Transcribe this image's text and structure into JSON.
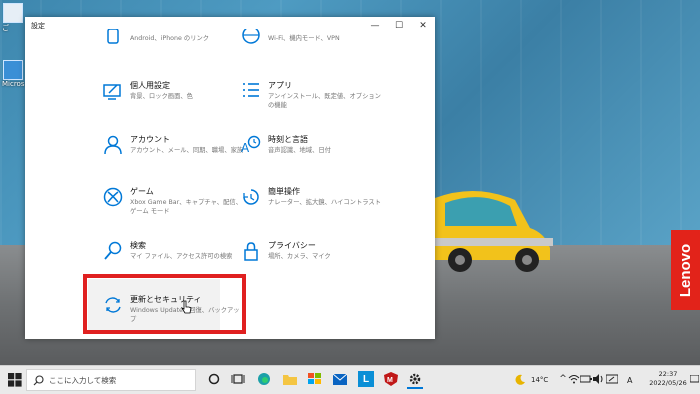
{
  "window": {
    "title": "設定",
    "controls": {
      "minimize": "—",
      "maximize": "☐",
      "close": "✕"
    }
  },
  "settings": {
    "partial_left": {
      "name": "",
      "desc": "Android、iPhone のリンク"
    },
    "partial_right": {
      "name": "",
      "desc": "Wi-Fi、機内モード、VPN"
    },
    "tiles": [
      {
        "id": "personalization",
        "name": "個人用設定",
        "desc": "背景、ロック画面、色",
        "icon": "personalization-icon"
      },
      {
        "id": "apps",
        "name": "アプリ",
        "desc": "アンインストール、既定値、オプションの機能",
        "icon": "apps-icon"
      },
      {
        "id": "accounts",
        "name": "アカウント",
        "desc": "アカウント、メール、同期、職場、家族",
        "icon": "person-icon"
      },
      {
        "id": "time-language",
        "name": "時刻と言語",
        "desc": "音声認識、地域、日付",
        "icon": "time-language-icon"
      },
      {
        "id": "gaming",
        "name": "ゲーム",
        "desc": "Xbox Game Bar、キャプチャ、配信、ゲーム モード",
        "icon": "xbox-icon"
      },
      {
        "id": "ease-of-access",
        "name": "簡単操作",
        "desc": "ナレーター、拡大鏡、ハイコントラスト",
        "icon": "ease-of-access-icon"
      },
      {
        "id": "search",
        "name": "検索",
        "desc": "マイ ファイル、アクセス許可の検索",
        "icon": "search-icon"
      },
      {
        "id": "privacy",
        "name": "プライバシー",
        "desc": "場所、カメラ、マイク",
        "icon": "lock-icon"
      },
      {
        "id": "update-security",
        "name": "更新とセキュリティ",
        "desc": "Windows Update、回復、バックアップ",
        "icon": "sync-icon"
      }
    ]
  },
  "desktop": {
    "icons": [
      {
        "label": "ご"
      },
      {
        "label": "Micros"
      }
    ],
    "brand": "Lenovo"
  },
  "taskbar": {
    "search_placeholder": "ここに入力して検索",
    "weather": "14°C",
    "ime": "A",
    "time": "22:37",
    "date": "2022/05/26"
  },
  "colors": {
    "accent": "#0078d7",
    "highlight": "#e02020",
    "lenovo": "#e2231a"
  }
}
